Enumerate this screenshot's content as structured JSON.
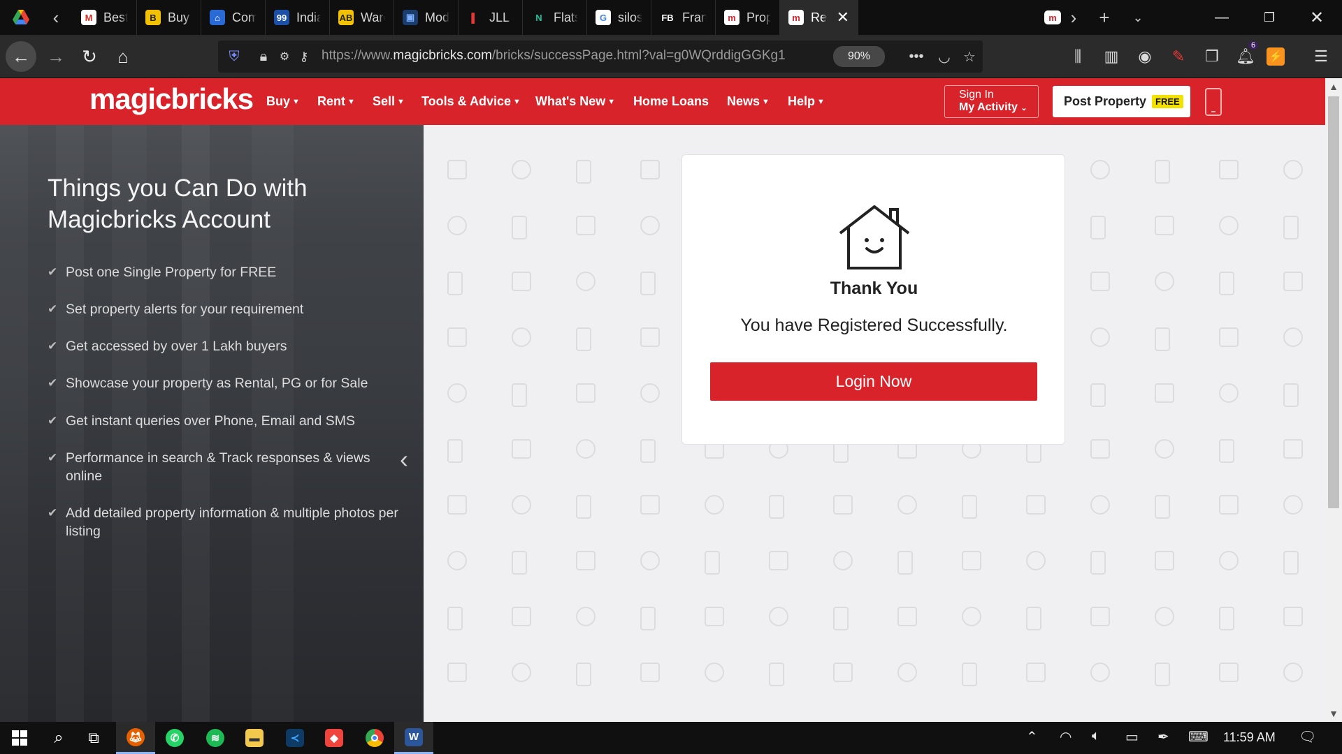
{
  "browser": {
    "tabs": [
      {
        "label": "Bestse",
        "icon": "gmail-icon",
        "glyph": "M",
        "color": "#ffffff",
        "fg": "#d93025"
      },
      {
        "label": "Buy M",
        "icon": "b-icon",
        "glyph": "B",
        "color": "#f2c200",
        "fg": "#222"
      },
      {
        "label": "Comm",
        "icon": "home-blue-icon",
        "glyph": "⌂",
        "color": "#2a6ad6",
        "fg": "#fff"
      },
      {
        "label": "India F",
        "icon": "99acres-icon",
        "glyph": "99",
        "color": "#1b4fa8",
        "fg": "#fff"
      },
      {
        "label": "Wareh",
        "icon": "ab-icon",
        "glyph": "AB",
        "color": "#f2c200",
        "fg": "#222"
      },
      {
        "label": "Moder",
        "icon": "modern-icon",
        "glyph": "▣",
        "color": "#1a3d6e",
        "fg": "#7fb0ff"
      },
      {
        "label": "JLL - P",
        "icon": "bars-icon",
        "glyph": "▌",
        "color": "#0f0f0f",
        "fg": "#e53935"
      },
      {
        "label": "Flats, F",
        "icon": "nb-icon",
        "glyph": "N",
        "color": "#0f0f0f",
        "fg": "#19c39a"
      },
      {
        "label": "silos -",
        "icon": "google-icon",
        "glyph": "G",
        "color": "#ffffff",
        "fg": "#4285f4"
      },
      {
        "label": "Franch",
        "icon": "fb-icon",
        "glyph": "FB",
        "color": "#0f0f0f",
        "fg": "#ffffff"
      },
      {
        "label": "Proper",
        "icon": "magicbricks-icon",
        "glyph": "m",
        "color": "#ffffff",
        "fg": "#d8232a"
      },
      {
        "label": "Re",
        "icon": "magicbricks-icon",
        "glyph": "m",
        "color": "#ffffff",
        "fg": "#d8232a",
        "active": true
      }
    ],
    "url_base": "https://www.",
    "url_host": "magicbricks.com",
    "url_path": "/bricks/successPage.html?val=g0WQrddigGGKg1",
    "zoom": "90%"
  },
  "site": {
    "logo": "magicbricks",
    "nav": [
      "Buy",
      "Rent",
      "Sell",
      "Tools & Advice",
      "What's New",
      "Home Loans",
      "News",
      "Help"
    ],
    "signin_line1": "Sign In",
    "signin_line2": "My Activity",
    "post_property": "Post Property",
    "free_tag": "FREE"
  },
  "left_panel": {
    "title": "Things you Can Do with Magicbricks Account",
    "features": [
      "Post one Single Property for FREE",
      "Set property alerts for your requirement",
      "Get accessed by over 1 Lakh buyers",
      "Showcase your property as Rental, PG or for Sale",
      "Get instant queries over Phone, Email and SMS",
      "Performance in search & Track responses & views online",
      "Add detailed property information & multiple photos per listing"
    ]
  },
  "card": {
    "title": "Thank You",
    "message": "You have Registered Successfully.",
    "button": "Login Now"
  },
  "taskbar": {
    "time": "11:59 AM",
    "notification_count": "6"
  }
}
